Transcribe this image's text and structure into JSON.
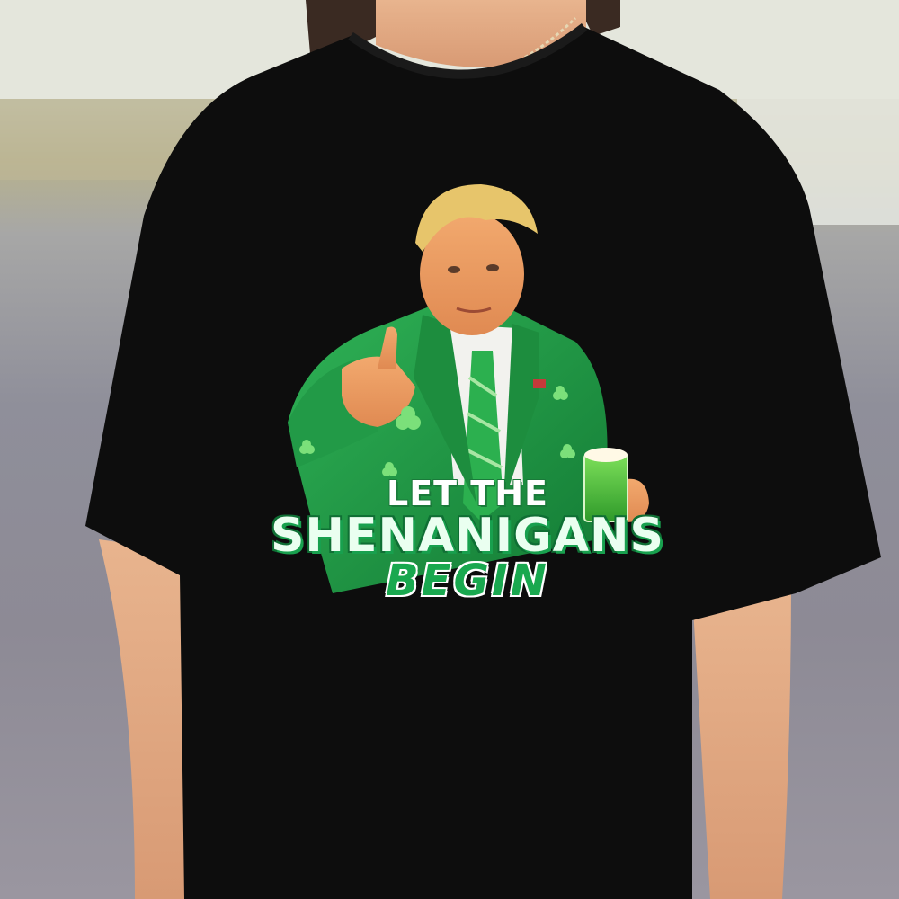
{
  "product": {
    "shirt_color": "#0d0d0d",
    "design": {
      "line_1": "LET THE",
      "line_2": "SHENANIGANS",
      "line_3": "BEGIN",
      "accent_color": "#18a04e",
      "suit_color": "#1f9a45"
    }
  }
}
